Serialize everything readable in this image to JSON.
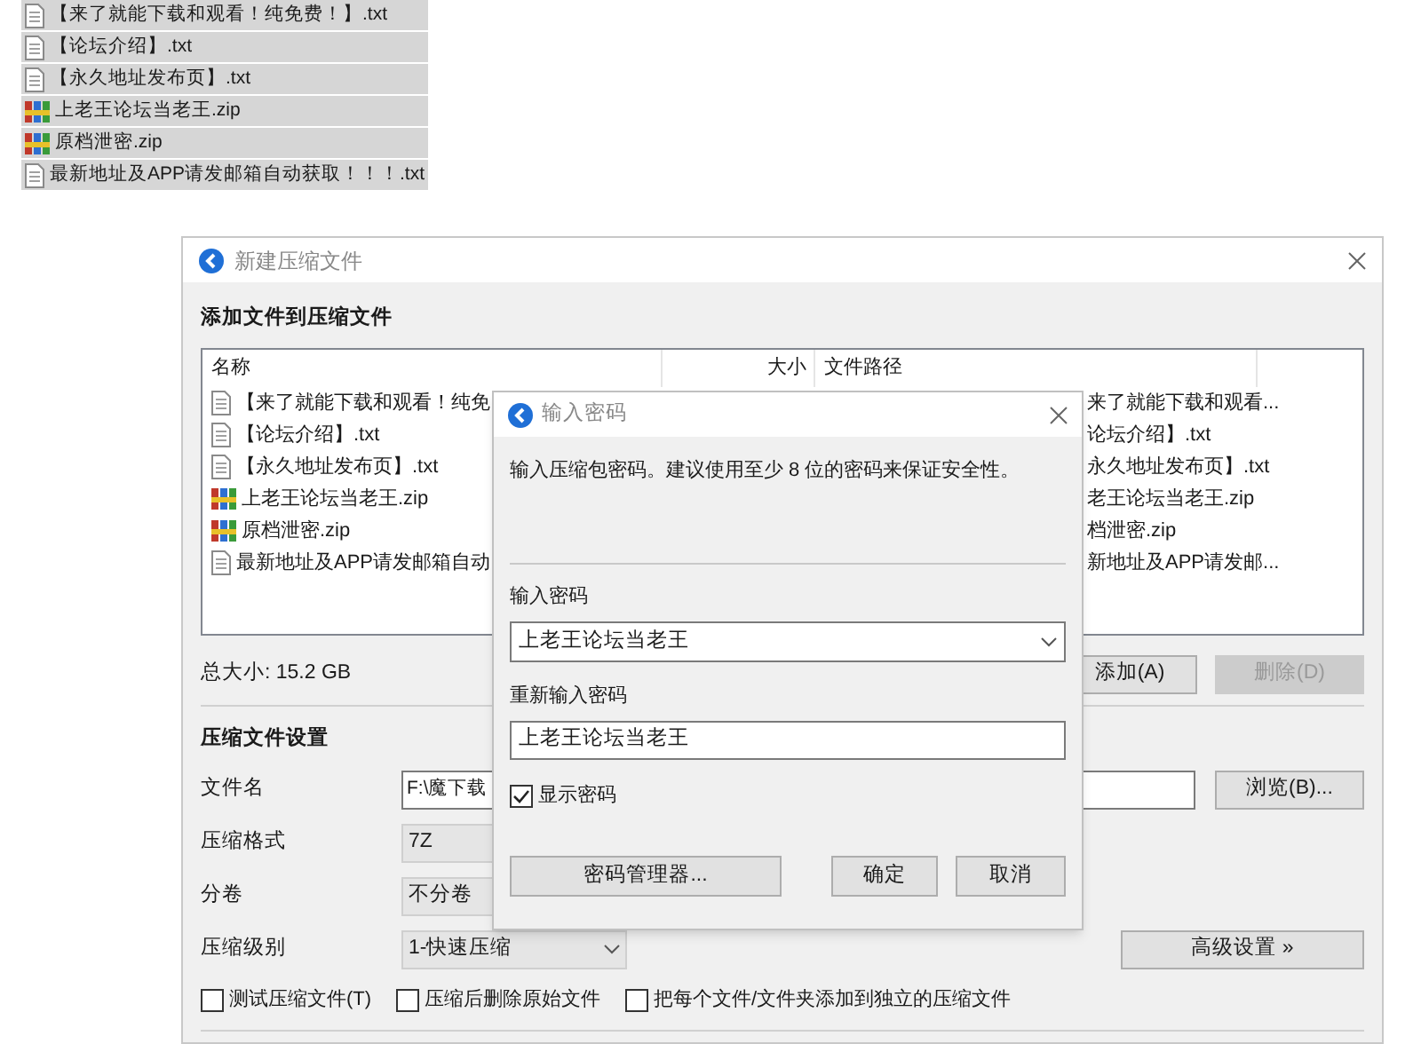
{
  "desktop_files": [
    {
      "name": "【来了就能下载和观看！纯免费！】.txt",
      "kind": "text"
    },
    {
      "name": "【论坛介绍】.txt",
      "kind": "text"
    },
    {
      "name": "【永久地址发布页】.txt",
      "kind": "text"
    },
    {
      "name": "上老王论坛当老王.zip",
      "kind": "archive"
    },
    {
      "name": "原档泄密.zip",
      "kind": "archive"
    },
    {
      "name": "最新地址及APP请发邮箱自动获取！！！.txt",
      "kind": "text"
    }
  ],
  "window": {
    "title": "新建压缩文件",
    "section_title": "添加文件到压缩文件",
    "file_list": {
      "columns": [
        "名称",
        "大小",
        "文件路径"
      ],
      "rows": [
        {
          "name": "【来了就能下载和观看！纯免",
          "path": "来了就能下载和观看...",
          "kind": "text"
        },
        {
          "name": "【论坛介绍】.txt",
          "path": "论坛介绍】.txt",
          "kind": "text"
        },
        {
          "name": "【永久地址发布页】.txt",
          "path": "永久地址发布页】.txt",
          "kind": "text"
        },
        {
          "name": "上老王论坛当老王.zip",
          "path": "老王论坛当老王.zip",
          "kind": "archive"
        },
        {
          "name": "原档泄密.zip",
          "path": "档泄密.zip",
          "kind": "archive"
        },
        {
          "name": "最新地址及APP请发邮箱自动",
          "path": "新地址及APP请发邮...",
          "kind": "text"
        }
      ]
    },
    "total_size": "总大小: 15.2 GB",
    "buttons": [
      {
        "label": "添加(A)",
        "disabled": false
      },
      {
        "label": "删除(D)",
        "disabled": true
      }
    ],
    "settings_title": "压缩文件设置",
    "fields": [
      {
        "label": "文件名",
        "kind": "text",
        "value": "F:\\魔下载"
      },
      {
        "label": "压缩格式",
        "kind": "covered_select",
        "value": "7Z"
      },
      {
        "label": "分卷",
        "kind": "covered_select",
        "value": "不分卷"
      },
      {
        "label": "压缩级别",
        "kind": "select",
        "value": "1-快速压缩"
      }
    ],
    "browse_button": "浏览(B)...",
    "advanced_button": "高级设置 »",
    "options": [
      {
        "label": "测试压缩文件(T)",
        "checked": false
      },
      {
        "label": "压缩后删除原始文件",
        "checked": false
      },
      {
        "label": "把每个文件/文件夹添加到独立的压缩文件",
        "checked": false
      }
    ]
  },
  "password_dialog": {
    "title": "输入密码",
    "message": "输入压缩包密码。建议使用至少 8 位的密码来保证安全性。",
    "password_label": "输入密码",
    "password": "上老王论坛当老王",
    "confirm_label": "重新输入密码",
    "confirm": "上老王论坛当老王",
    "show_password": {
      "label": "显示密码",
      "checked": true
    },
    "buttons": [
      "密码管理器...",
      "确定",
      "取消"
    ]
  }
}
